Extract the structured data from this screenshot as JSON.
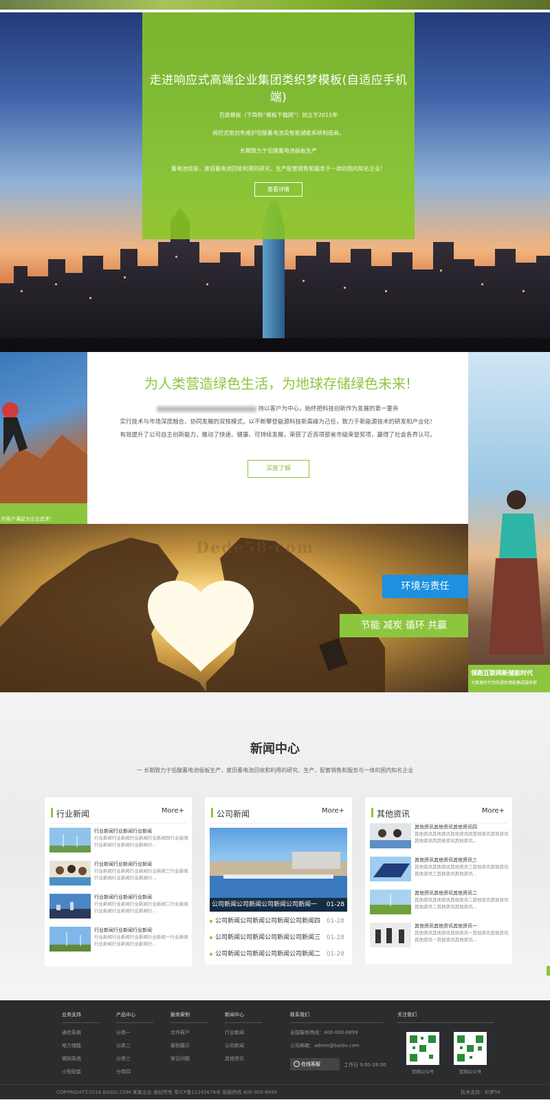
{
  "hero": {
    "title": "走进响应式高端企业集团类织梦模板(自适应手机端)",
    "lines": [
      "百度模板（下简称“模板下载网”）创立于2015年",
      "阀控式密封免维护铅酸蓄电池及智能储能系统制造商。",
      "长期致力于铅酸蓄电池极板生产",
      "蓄电池组装，废旧蓄电池回收利用的研究、生产配套销售和服务于一体的国内知名企业！"
    ],
    "button": "查看详情"
  },
  "about": {
    "title": "为人类营造绿色生活，为地球存储绿色未来!",
    "line1_suffix": "持以客户为中心，始终把科技创新作为发展的第一要务",
    "line2": "实行技术与市场深度融合、协同发展的双核模式，以不断攀登能源科技新高峰为己任，致力于新能源技术的研发和产业化！",
    "line3": "有效提升了公司自主创新能力，推动了快速、健康、可持续发展，荣获了近百项部省市级荣誉奖项，赢得了社会各界认可。",
    "button": "深度了解",
    "left_caption": "的客户满足为企业追求！",
    "right_caption_title": "领跑互联网新储能时代",
    "right_caption_sub": "大数据时代领先绿色储能集成服务供"
  },
  "banner": {
    "watermark": "Dede58·com",
    "tag1": "环境与责任",
    "tag2": "节能  减炭  循环 共赢"
  },
  "news": {
    "title": "新闻中心",
    "subtitle": "一 长期致力于铅酸蓄电池极板生产，废旧蓄电池回收和利用的研究、生产、配套销售和服务与一体的国内知名企业",
    "more": "More+",
    "industry": {
      "name": "行业新闻",
      "items": [
        {
          "title": "行业新闻行业新闻行业新闻",
          "desc": "行业新闻行业新闻行业新闻行业新闻四行业新闻行业新闻行业新闻行业新闻行..."
        },
        {
          "title": "行业新闻行业新闻行业新闻",
          "desc": "行业新闻行业新闻行业新闻行业新闻三行业新闻行业新闻行业新闻行业新闻行..."
        },
        {
          "title": "行业新闻行业新闻行业新闻",
          "desc": "行业新闻行业新闻行业新闻行业新闻二行业新闻行业新闻行业新闻行业新闻行..."
        },
        {
          "title": "行业新闻行业新闻行业新闻",
          "desc": "行业新闻行业新闻行业新闻行业新闻一行业新闻行业新闻行业新闻行业新闻行..."
        }
      ]
    },
    "company": {
      "name": "公司新闻",
      "featured": {
        "title": "公司新闻公司新闻公司新闻公司新闻一",
        "date": "01-28"
      },
      "items": [
        {
          "title": "公司新闻公司新闻公司新闻公司新闻四",
          "date": "01-28"
        },
        {
          "title": "公司新闻公司新闻公司新闻公司新闻三",
          "date": "01-28"
        },
        {
          "title": "公司新闻公司新闻公司新闻公司新闻二",
          "date": "01-28"
        }
      ]
    },
    "other": {
      "name": "其他资讯",
      "items": [
        {
          "title": "其他资讯其他资讯其他资讯四",
          "desc": "其他资讯其他资讯其他资讯四其他资讯其他资讯其他资讯四其他资讯其他资讯..."
        },
        {
          "title": "其他资讯其他资讯其他资讯三",
          "desc": "其他资讯其他资讯其他资讯三其他资讯其他资讯其他资讯三其他资讯其他资讯..."
        },
        {
          "title": "其他资讯其他资讯其他资讯二",
          "desc": "其他资讯其他资讯其他资讯二其他资讯其他资讯其他资讯二其他资讯其他资讯..."
        },
        {
          "title": "其他资讯其他资讯其他资讯一",
          "desc": "其他资讯其他资讯其他资讯一其他资讯其他资讯其他资讯一其他资讯其他资讯..."
        }
      ]
    }
  },
  "footer": {
    "cols": [
      {
        "head": "业务支持",
        "links": [
          "通信系统",
          "电力储能",
          "微网系统",
          "小型配套"
        ]
      },
      {
        "head": "产品中心",
        "links": [
          "分类一",
          "分类二",
          "分类三",
          "分类四"
        ]
      },
      {
        "head": "服务案例",
        "links": [
          "合作客户",
          "案例展示",
          "常见问题"
        ]
      },
      {
        "head": "新闻中心",
        "links": [
          "行业新闻",
          "公司新闻",
          "其他资讯"
        ]
      }
    ],
    "contact_head": "联系我们",
    "hotline": "全国服务热线：400-000-8899",
    "email": "公司邮箱：admin@baidu.com",
    "service_btn": "在线客服",
    "hours": "工作日 9:00-18:00",
    "follow_head": "关注我们",
    "qr1": "官网公众号",
    "qr2": "官网公众号",
    "copyright": "COPYRIGHT©2016 BAIDU.COM 某某企业 版权所有 粤ICP备12345678号 客服热线 400-000-8899",
    "support": "技术支持：织梦58"
  },
  "colors": {
    "accent": "#8cc63f",
    "blue": "#1e90e0",
    "footer": "#2b2c2e"
  }
}
